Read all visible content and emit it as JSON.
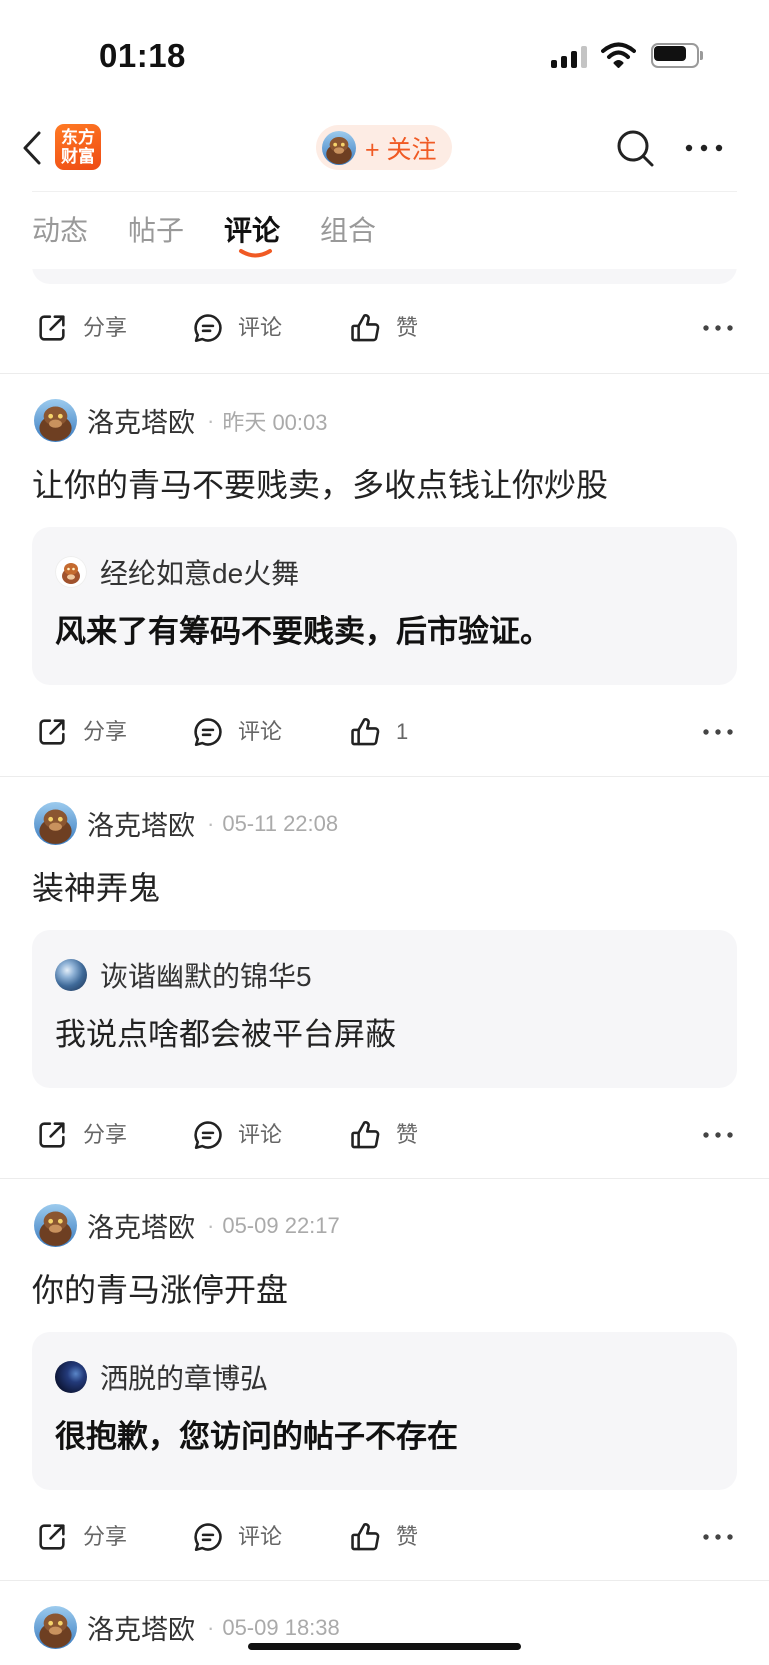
{
  "status_bar": {
    "time": "01:18",
    "signal_bars_active": 3,
    "signal_bars_total": 4,
    "battery_level": 0.75
  },
  "colors": {
    "accent": "#f05a24",
    "follow_bg": "#fdece4",
    "quote_bg": "#f6f6f8"
  },
  "icons": {
    "back": "chevron-left-icon",
    "search": "search-icon",
    "more": "more-dots-icon",
    "share": "share-icon",
    "comment": "comment-icon",
    "like": "thumbs-up-icon"
  },
  "header": {
    "logo": {
      "line1": "东方",
      "line2": "财富"
    },
    "follow_label": "+ 关注"
  },
  "tabs": [
    {
      "label": "动态"
    },
    {
      "label": "帖子"
    },
    {
      "label": "评论"
    },
    {
      "label": "组合"
    }
  ],
  "active_tab": "评论",
  "meta_separator": "·",
  "prev_post": {
    "actions": {
      "share": "分享",
      "comment": "评论",
      "like": "赞"
    }
  },
  "posts": [
    {
      "author": "洛克塔欧",
      "time": "昨天 00:03",
      "content": "让你的青马不要贱卖，多收点钱让你炒股",
      "quote": {
        "author": "经纶如意de火舞",
        "text": "风来了有筹码不要贱卖，后市验证。"
      },
      "actions": {
        "share": "分享",
        "comment": "评论",
        "like": "1"
      }
    },
    {
      "author": "洛克塔欧",
      "time": "05-11 22:08",
      "content": "装神弄鬼",
      "quote": {
        "author": "诙谐幽默的锦华5",
        "text": "我说点啥都会被平台屏蔽"
      },
      "actions": {
        "share": "分享",
        "comment": "评论",
        "like": "赞"
      }
    },
    {
      "author": "洛克塔欧",
      "time": "05-09 22:17",
      "content": "你的青马涨停开盘",
      "quote": {
        "author": "洒脱的章博弘",
        "text": "很抱歉，您访问的帖子不存在"
      },
      "actions": {
        "share": "分享",
        "comment": "评论",
        "like": "赞"
      }
    },
    {
      "author": "洛克塔欧",
      "time": "05-09 18:38"
    }
  ]
}
